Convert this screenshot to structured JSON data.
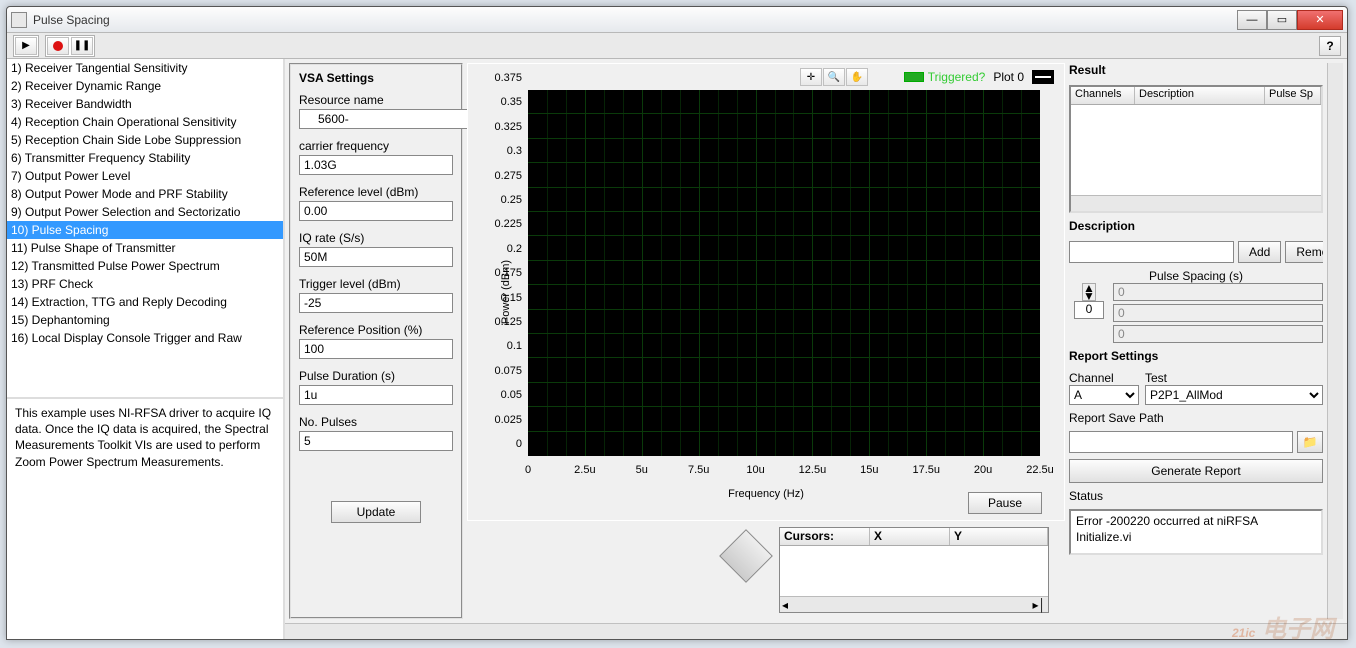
{
  "window": {
    "title": "Pulse Spacing"
  },
  "toolbar": {},
  "sidebar": {
    "tests": [
      "1) Receiver Tangential Sensitivity",
      "2) Receiver Dynamic Range",
      "3) Receiver Bandwidth",
      "4) Reception Chain Operational Sensitivity",
      "5) Reception Chain Side Lobe Suppression",
      "6) Transmitter Frequency Stability",
      "7) Output Power Level",
      "8) Output Power Mode and PRF Stability",
      "9) Output Power Selection and Sectorizatio",
      "10) Pulse Spacing",
      "11) Pulse Shape of Transmitter",
      "12) Transmitted Pulse Power Spectrum",
      "13) PRF Check",
      "14) Extraction, TTG and Reply Decoding",
      "15) Dephantoming",
      "16) Local Display Console Trigger and Raw"
    ],
    "selected_index": 9,
    "description": "This example uses NI-RFSA driver to acquire IQ data. Once the IQ data is acquired, the Spectral Measurements Toolkit VIs are used to perform Zoom Power Spectrum Measurements."
  },
  "vsa": {
    "heading": "VSA Settings",
    "resource_name_label": "Resource name",
    "resource_name": "5600-",
    "carrier_label": "carrier frequency",
    "carrier": "1.03G",
    "ref_level_label": "Reference level (dBm)",
    "ref_level": "0.00",
    "iq_rate_label": "IQ rate (S/s)",
    "iq_rate": "50M",
    "trigger_level_label": "Trigger level (dBm)",
    "trigger_level": "-25",
    "ref_pos_label": "Reference Position (%)",
    "ref_pos": "100",
    "pulse_dur_label": "Pulse Duration (s)",
    "pulse_dur": "1u",
    "no_pulses_label": "No. Pulses",
    "no_pulses": "5",
    "update_label": "Update"
  },
  "chart_data": {
    "type": "line",
    "title": "",
    "xlabel": "Frequency (Hz)",
    "ylabel": "Power (dBm)",
    "x_ticks": [
      "0",
      "2.5u",
      "5u",
      "7.5u",
      "10u",
      "12.5u",
      "15u",
      "17.5u",
      "20u",
      "22.5u"
    ],
    "y_ticks": [
      "0",
      "0.025",
      "0.05",
      "0.075",
      "0.1",
      "0.125",
      "0.15",
      "0.175",
      "0.2",
      "0.225",
      "0.25",
      "0.275",
      "0.3",
      "0.325",
      "0.35",
      "0.375"
    ],
    "xlim": [
      0,
      2.25e-05
    ],
    "ylim": [
      0,
      0.375
    ],
    "series": [
      {
        "name": "Plot 0",
        "values": []
      }
    ],
    "triggered_label": "Triggered?",
    "plot_label": "Plot 0",
    "pause_label": "Pause"
  },
  "cursors": {
    "heading": "Cursors:",
    "col_x": "X",
    "col_y": "Y"
  },
  "result": {
    "heading": "Result",
    "col_channels": "Channels",
    "col_desc": "Description",
    "col_ps": "Pulse Sp",
    "desc_label": "Description",
    "add_label": "Add",
    "remove_label": "Remove"
  },
  "pulse_spacing": {
    "label": "Pulse Spacing (s)",
    "index": "0",
    "values": [
      "0",
      "0",
      "0"
    ]
  },
  "report": {
    "heading": "Report Settings",
    "channel_label": "Channel",
    "test_label": "Test",
    "channel": "A",
    "test": "P2P1_AllMod",
    "path_label": "Report Save Path",
    "path": "",
    "generate_label": "Generate Report"
  },
  "status": {
    "label": "Status",
    "text": "Error -200220 occurred at niRFSA Initialize.vi"
  }
}
